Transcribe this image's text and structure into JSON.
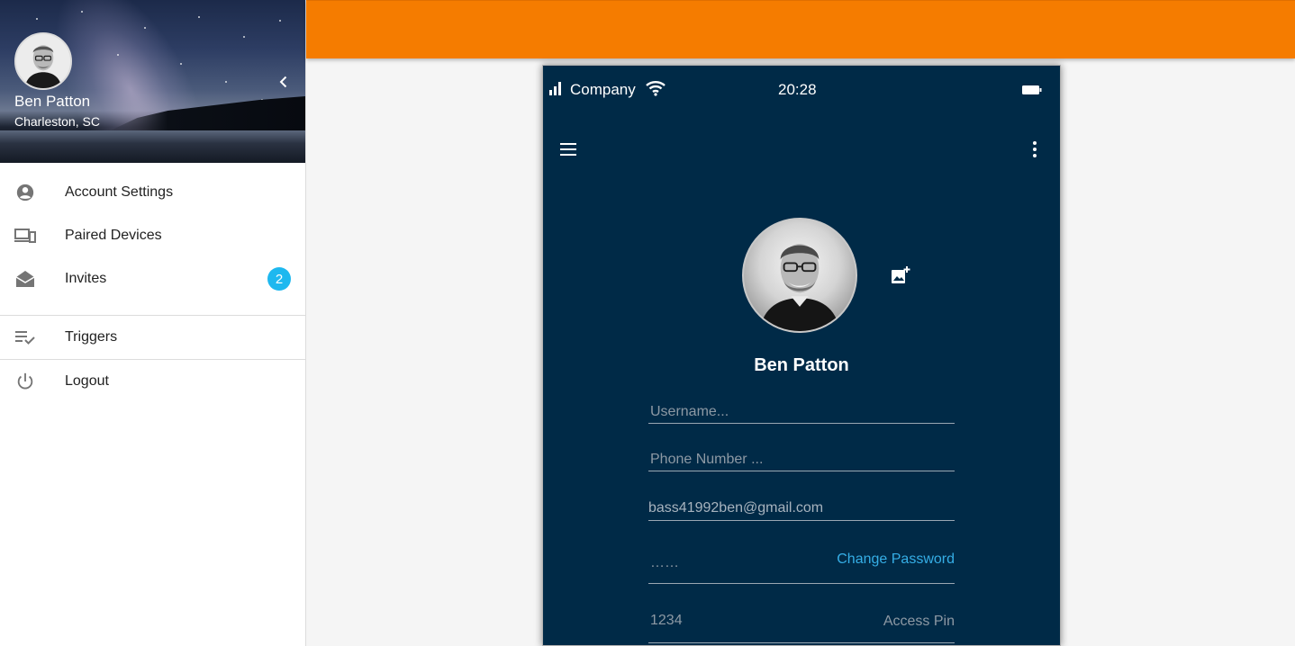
{
  "sidebar": {
    "profile": {
      "name": "Ben Patton",
      "location": "Charleston, SC",
      "avatar_icon": "user-photo"
    },
    "collapse_icon": "chevron-left-icon",
    "items": [
      {
        "label": "Account Settings",
        "icon": "account-circle-icon"
      },
      {
        "label": "Paired Devices",
        "icon": "devices-icon"
      },
      {
        "label": "Invites",
        "icon": "mail-open-icon",
        "badge": "2"
      },
      {
        "label": "Triggers",
        "icon": "playlist-check-icon"
      },
      {
        "label": "Logout",
        "icon": "power-icon"
      }
    ]
  },
  "topbar": {
    "color": "#f57c00"
  },
  "phone": {
    "status_bar": {
      "carrier": "Company",
      "time": "20:28"
    },
    "toolbar": {
      "menu_icon": "hamburger-icon",
      "more_icon": "more-vert-icon"
    },
    "profile": {
      "name": "Ben Patton",
      "add_photo_icon": "add-photo-icon"
    },
    "form": {
      "username_placeholder": "Username...",
      "phone_placeholder": "Phone Number ...",
      "email": "bass41992ben@gmail.com",
      "password_mask": "……",
      "change_password_label": "Change Password",
      "pin_value": "1234",
      "pin_label": "Access Pin"
    }
  },
  "colors": {
    "accent": "#1eb8ef",
    "link": "#35aee6",
    "phone_bg": "#002a47",
    "orange": "#f57c00"
  }
}
